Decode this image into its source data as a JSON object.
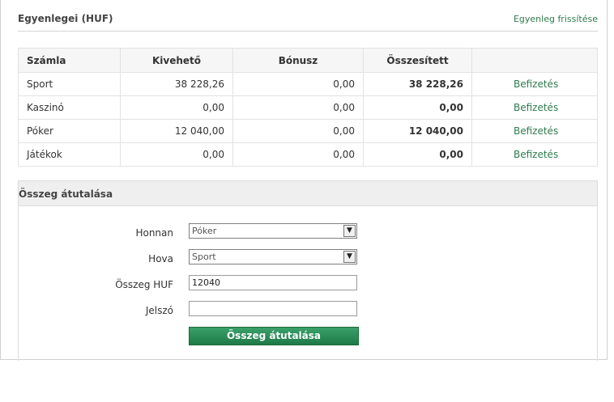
{
  "header": {
    "title": "Egyenlegei (HUF)",
    "refresh_link": "Egyenleg frissítése"
  },
  "table": {
    "columns": [
      "Számla",
      "Kivehető",
      "Bónusz",
      "Összesített",
      ""
    ],
    "rows": [
      {
        "account": "Sport",
        "withdrawable": "38 228,26",
        "bonus": "0,00",
        "total": "38 228,26",
        "action": "Befizetés"
      },
      {
        "account": "Kaszinó",
        "withdrawable": "0,00",
        "bonus": "0,00",
        "total": "0,00",
        "action": "Befizetés"
      },
      {
        "account": "Póker",
        "withdrawable": "12 040,00",
        "bonus": "0,00",
        "total": "12 040,00",
        "action": "Befizetés"
      },
      {
        "account": "Játékok",
        "withdrawable": "0,00",
        "bonus": "0,00",
        "total": "0,00",
        "action": "Befizetés"
      }
    ]
  },
  "transfer": {
    "title": "Összeg átutalása",
    "from_label": "Honnan",
    "from_value": "Póker",
    "to_label": "Hova",
    "to_value": "Sport",
    "amount_label": "Összeg HUF",
    "amount_value": "12040",
    "password_label": "Jelszó",
    "password_value": "",
    "submit_label": "Összeg átutalása"
  },
  "colors": {
    "accent": "#2f7b4d",
    "button": "#1e7a48"
  }
}
